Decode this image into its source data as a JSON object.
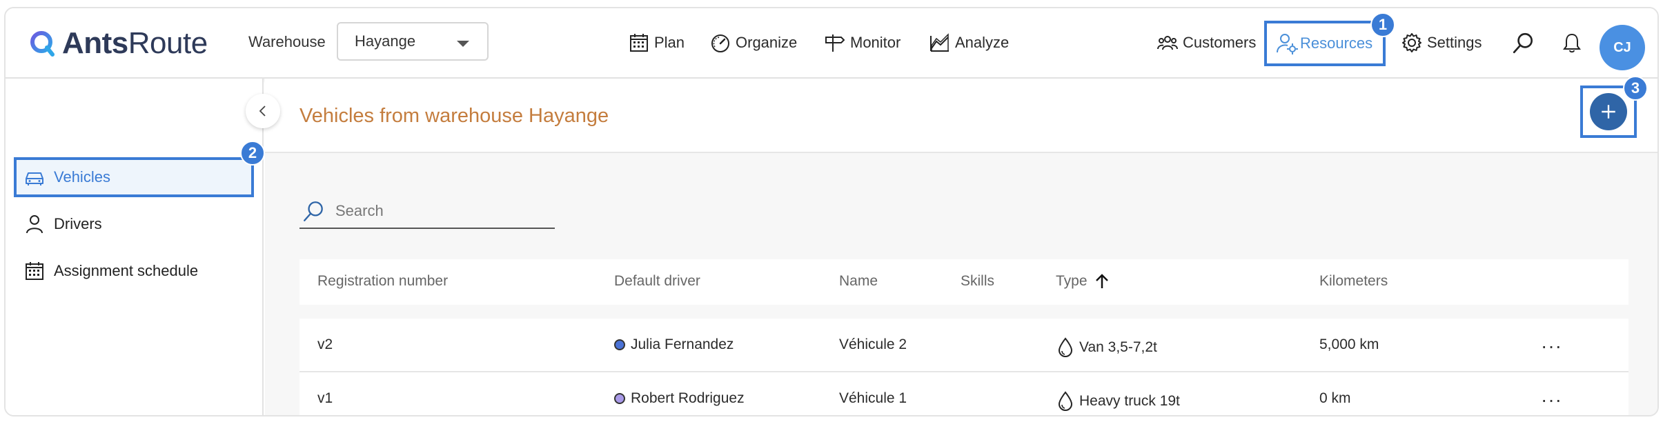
{
  "app": {
    "logo_bold": "Ants",
    "logo_light": "Route"
  },
  "header": {
    "warehouse_label": "Warehouse",
    "warehouse_value": "Hayange",
    "nav": [
      {
        "label": "Plan",
        "icon": "calendar-icon"
      },
      {
        "label": "Organize",
        "icon": "gauge-icon"
      },
      {
        "label": "Monitor",
        "icon": "signpost-icon"
      },
      {
        "label": "Analyze",
        "icon": "chart-icon"
      }
    ],
    "right_nav": [
      {
        "label": "Customers",
        "icon": "users-icon"
      },
      {
        "label": "Resources",
        "icon": "user-gear-icon"
      },
      {
        "label": "Settings",
        "icon": "gear-icon"
      }
    ],
    "avatar_initials": "CJ"
  },
  "badges": {
    "resources": "1",
    "vehicles": "2",
    "add": "3"
  },
  "sidebar": {
    "items": [
      {
        "label": "Vehicles",
        "icon": "car-icon",
        "active": true
      },
      {
        "label": "Drivers",
        "icon": "person-icon",
        "active": false
      },
      {
        "label": "Assignment schedule",
        "icon": "calendar-icon",
        "active": false
      }
    ]
  },
  "main": {
    "title": "Vehicles from warehouse Hayange",
    "search_placeholder": "Search",
    "columns": [
      "Registration number",
      "Default driver",
      "Name",
      "Skills",
      "Type",
      "Kilometers"
    ],
    "sort_column": "Type",
    "rows": [
      {
        "registration": "v2",
        "driver": "Julia Fernandez",
        "driver_color": "#4a72d6",
        "name": "Véhicule 2",
        "skills": "",
        "type": "Van 3,5-7,2t",
        "kilometers": "5,000 km",
        "menu": "···"
      },
      {
        "registration": "v1",
        "driver": "Robert Rodriguez",
        "driver_color": "#a99ae8",
        "name": "Véhicule 1",
        "skills": "",
        "type": "Heavy truck 19t",
        "kilometers": "0 km",
        "menu": "···"
      }
    ]
  },
  "colors": {
    "accent": "#3a7bd5",
    "title": "#c47d3e",
    "avatar": "#4a90e2",
    "add_button": "#2f65a7"
  }
}
